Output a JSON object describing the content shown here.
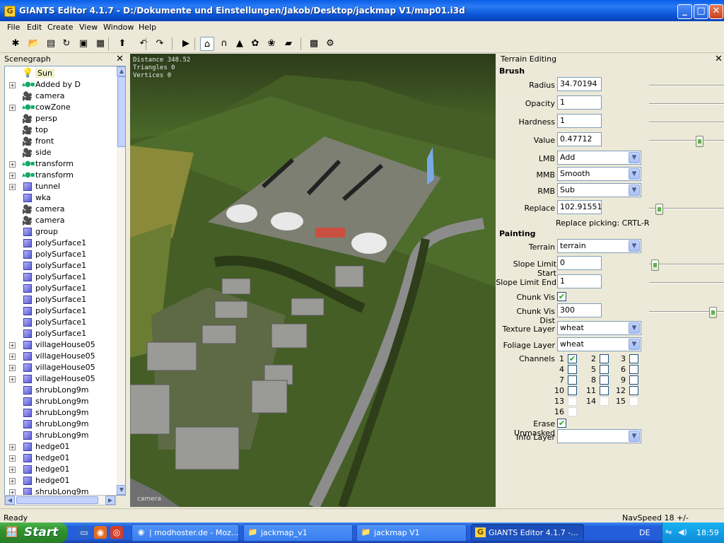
{
  "window": {
    "title": "GIANTS Editor 4.1.7 - D:/Dokumente und Einstellungen/Jakob/Desktop/jackmap V1/map01.i3d",
    "app_icon": "G",
    "buttons": {
      "minimize": "_",
      "maximize": "□",
      "close": "✕"
    }
  },
  "menu": [
    "File",
    "Edit",
    "Create",
    "View",
    "Window",
    "Help"
  ],
  "toolbar": [
    {
      "icon": "new-scene-icon",
      "glyph": "✱"
    },
    {
      "icon": "open-file-icon",
      "glyph": "📂"
    },
    {
      "icon": "document-icon",
      "glyph": "▤"
    },
    {
      "icon": "refresh-icon",
      "glyph": "↻"
    },
    {
      "icon": "save-icon",
      "glyph": "▣"
    },
    {
      "icon": "save-all-icon",
      "glyph": "▦"
    },
    {
      "icon": "import-icon",
      "glyph": "⬆"
    },
    {
      "icon": "undo-icon",
      "glyph": "↶"
    },
    {
      "icon": "redo-icon",
      "glyph": "↷"
    },
    {
      "icon": "play-icon",
      "glyph": "▶"
    },
    {
      "icon": "select-icon",
      "glyph": "⌂"
    },
    {
      "icon": "terrain-sculpt-icon",
      "glyph": "∩"
    },
    {
      "icon": "terrain-paint-icon",
      "glyph": "▲"
    },
    {
      "icon": "foliage-paint-icon",
      "glyph": "✿"
    },
    {
      "icon": "foliage-tool-icon",
      "glyph": "❀"
    },
    {
      "icon": "terrain-texture-icon",
      "glyph": "▰"
    },
    {
      "icon": "checker-icon",
      "glyph": "▩"
    },
    {
      "icon": "gear-icon",
      "glyph": "⚙"
    }
  ],
  "scenegraph": {
    "title": "Scenegraph",
    "close": "✕",
    "nodes": [
      {
        "label": "Sun",
        "icon": "sun",
        "expandable": false
      },
      {
        "label": "Added by D",
        "icon": "transform",
        "expandable": true
      },
      {
        "label": "camera",
        "icon": "camera",
        "expandable": false
      },
      {
        "label": "cowZone",
        "icon": "transform",
        "expandable": true
      },
      {
        "label": "persp",
        "icon": "camera",
        "expandable": false
      },
      {
        "label": "top",
        "icon": "camera",
        "expandable": false
      },
      {
        "label": "front",
        "icon": "camera",
        "expandable": false
      },
      {
        "label": "side",
        "icon": "camera",
        "expandable": false
      },
      {
        "label": "transform",
        "icon": "transform",
        "expandable": true
      },
      {
        "label": "transform",
        "icon": "transform",
        "expandable": true
      },
      {
        "label": "tunnel",
        "icon": "shape",
        "expandable": true
      },
      {
        "label": "wka",
        "icon": "shape",
        "expandable": false
      },
      {
        "label": "camera",
        "icon": "camera",
        "expandable": false
      },
      {
        "label": "camera",
        "icon": "camera",
        "expandable": false
      },
      {
        "label": "group",
        "icon": "shape",
        "expandable": false
      },
      {
        "label": "polySurface1",
        "icon": "shape",
        "expandable": false
      },
      {
        "label": "polySurface1",
        "icon": "shape",
        "expandable": false
      },
      {
        "label": "polySurface1",
        "icon": "shape",
        "expandable": false
      },
      {
        "label": "polySurface1",
        "icon": "shape",
        "expandable": false
      },
      {
        "label": "polySurface1",
        "icon": "shape",
        "expandable": false
      },
      {
        "label": "polySurface1",
        "icon": "shape",
        "expandable": false
      },
      {
        "label": "polySurface1",
        "icon": "shape",
        "expandable": false
      },
      {
        "label": "polySurface1",
        "icon": "shape",
        "expandable": false
      },
      {
        "label": "polySurface1",
        "icon": "shape",
        "expandable": false
      },
      {
        "label": "villageHouse05",
        "icon": "shape",
        "expandable": true
      },
      {
        "label": "villageHouse05",
        "icon": "shape",
        "expandable": true
      },
      {
        "label": "villageHouse05",
        "icon": "shape",
        "expandable": true
      },
      {
        "label": "villageHouse05",
        "icon": "shape",
        "expandable": true
      },
      {
        "label": "shrubLong9m",
        "icon": "shape",
        "expandable": false
      },
      {
        "label": "shrubLong9m",
        "icon": "shape",
        "expandable": false
      },
      {
        "label": "shrubLong9m",
        "icon": "shape",
        "expandable": false
      },
      {
        "label": "shrubLong9m",
        "icon": "shape",
        "expandable": false
      },
      {
        "label": "shrubLong9m",
        "icon": "shape",
        "expandable": false
      },
      {
        "label": "hedge01",
        "icon": "shape",
        "expandable": true
      },
      {
        "label": "hedge01",
        "icon": "shape",
        "expandable": true
      },
      {
        "label": "hedge01",
        "icon": "shape",
        "expandable": true
      },
      {
        "label": "hedge01",
        "icon": "shape",
        "expandable": true
      },
      {
        "label": "shrubLong9m",
        "icon": "shape",
        "expandable": true
      }
    ]
  },
  "viewport": {
    "stats": {
      "distance": "Distance 348.52",
      "triangles": "Triangles 0",
      "vertices": "Vertices 0"
    },
    "camera_label": "camera"
  },
  "terrain_editing": {
    "title": "Terrain Editing",
    "close": "✕",
    "brush_heading": "Brush",
    "radius": {
      "label": "Radius",
      "value": "34.70194"
    },
    "opacity": {
      "label": "Opacity",
      "value": "1"
    },
    "hardness": {
      "label": "Hardness",
      "value": "1"
    },
    "value": {
      "label": "Value",
      "value": "0.47712"
    },
    "lmb": {
      "label": "LMB",
      "value": "Add"
    },
    "mmb": {
      "label": "MMB",
      "value": "Smooth"
    },
    "rmb": {
      "label": "RMB",
      "value": "Sub"
    },
    "replace": {
      "label": "Replace",
      "value": "102.91551"
    },
    "replace_hint": "Replace picking: CRTL-R",
    "painting_heading": "Painting",
    "terrain": {
      "label": "Terrain",
      "value": "terrain"
    },
    "slope_start": {
      "label": "Slope Limit Start",
      "value": "0"
    },
    "slope_end": {
      "label": "Slope Limit End",
      "value": "1"
    },
    "chunk_vis": {
      "label": "Chunk Vis",
      "checked": true
    },
    "chunk_vis_dist": {
      "label": "Chunk Vis Dist",
      "value": "300"
    },
    "texture_layer": {
      "label": "Texture Layer",
      "value": "wheat"
    },
    "foliage_layer": {
      "label": "Foliage Layer",
      "value": "wheat"
    },
    "channels_label": "Channels",
    "channels": [
      {
        "n": "1",
        "checked": true
      },
      {
        "n": "2",
        "checked": false
      },
      {
        "n": "3",
        "checked": false
      },
      {
        "n": "4",
        "checked": false
      },
      {
        "n": "5",
        "checked": false
      },
      {
        "n": "6",
        "checked": false
      },
      {
        "n": "7",
        "checked": false
      },
      {
        "n": "8",
        "checked": false
      },
      {
        "n": "9",
        "checked": false
      },
      {
        "n": "10",
        "checked": false
      },
      {
        "n": "11",
        "checked": false
      },
      {
        "n": "12",
        "checked": false
      },
      {
        "n": "13",
        "checked": false
      },
      {
        "n": "14",
        "checked": false
      },
      {
        "n": "15",
        "checked": false
      },
      {
        "n": "16",
        "checked": false
      }
    ],
    "erase_unmasked": {
      "label": "Erase Unmasked",
      "checked": true
    },
    "info_layer": {
      "label": "Info Layer",
      "value": ""
    },
    "slider_levels": {
      "radius": 1.0,
      "opacity": 1.0,
      "hardness": 1.0,
      "value": 0.7,
      "replace": 0.1,
      "slope_start": 0.03,
      "slope_end": 1.0,
      "chunk_vis_dist": 0.9
    }
  },
  "status": {
    "left": "Ready",
    "right": "NavSpeed 18 +/-"
  },
  "taskbar": {
    "start": "Start",
    "tasks": [
      {
        "label": "| modhoster.de - Moz...",
        "icon": "firefox-icon",
        "active": false
      },
      {
        "label": "jackmap_v1",
        "icon": "folder-icon",
        "active": false
      },
      {
        "label": "jackmap V1",
        "icon": "folder-icon",
        "active": false
      },
      {
        "label": "GIANTS Editor 4.1.7 -...",
        "icon": "giants-editor-icon",
        "active": true
      }
    ],
    "language": "DE",
    "clock": "18:59"
  },
  "colors": {
    "titlebar": "#0a5ee8",
    "panel": "#ece9d8",
    "grass": "#3e5520",
    "check": "#21a121"
  }
}
